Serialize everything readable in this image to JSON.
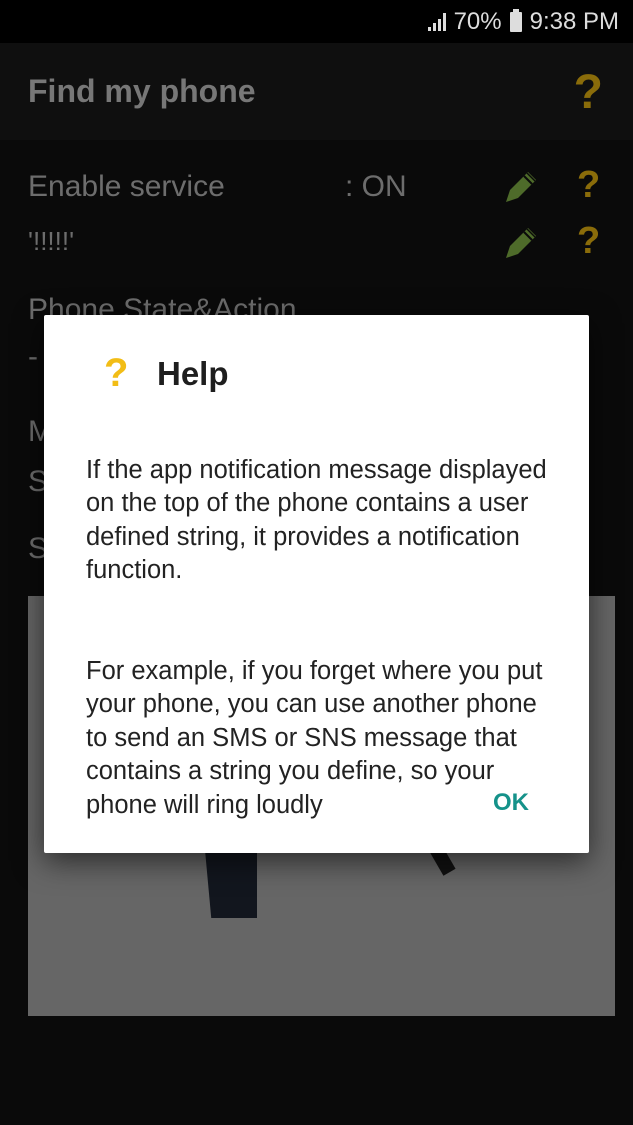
{
  "status_bar": {
    "battery_percent": "70%",
    "time": "9:38 PM",
    "signal_icon": "signal-icon",
    "battery_icon": "battery-icon"
  },
  "app_bar": {
    "title": "Find my phone",
    "help_icon": "?"
  },
  "settings": [
    {
      "label": "Enable service",
      "value": ": ON",
      "edit_icon": "pencil-icon",
      "help_icon": "?"
    },
    {
      "label": "'!!!!!'",
      "value": "",
      "edit_icon": "pencil-icon",
      "help_icon": "?"
    }
  ],
  "obscured_rows": [
    {
      "label": "Phone State&Action"
    },
    {
      "label": "-"
    },
    {
      "label": "M"
    },
    {
      "label": "S"
    },
    {
      "label": "S"
    }
  ],
  "colors": {
    "accent_yellow": "#f2bd16",
    "dim_yellow": "#8a6c0a",
    "pencil_green": "#4e6b2a",
    "ok_teal": "#15928a"
  },
  "dialog": {
    "icon": "?",
    "title": "Help",
    "paragraphs": [
      "If the app notification message displayed on the top of the phone contains a user defined string, it provides a notification function.",
      "For example, if you forget where you put your phone, you can use another phone to send an SMS or SNS message that contains a string you define, so your phone will ring loudly"
    ],
    "ok_label": "OK"
  }
}
